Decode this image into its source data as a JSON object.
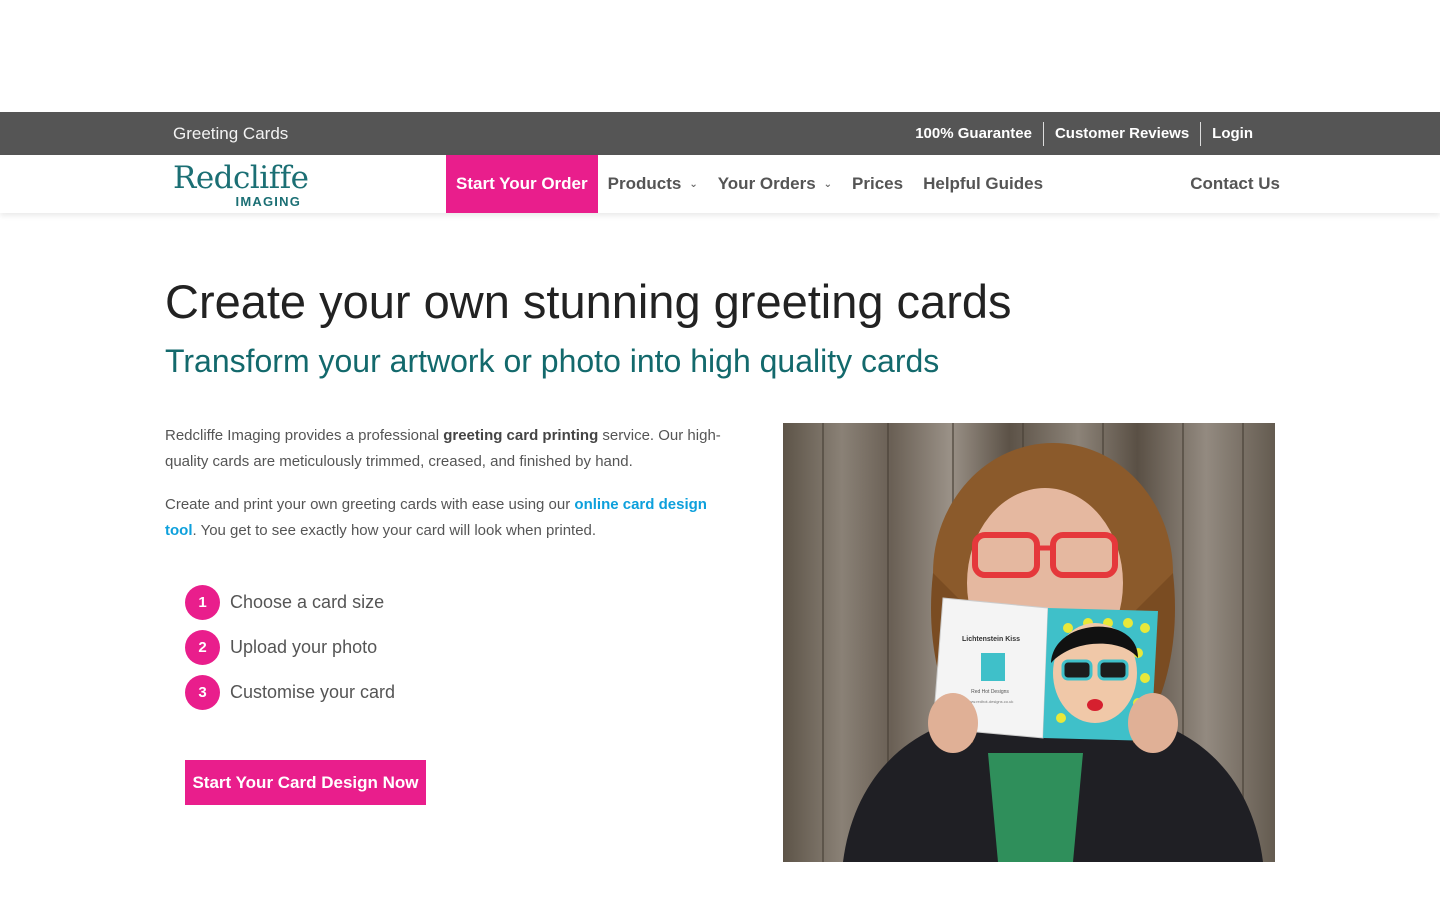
{
  "topbar": {
    "section_title": "Greeting Cards",
    "links": [
      "100% Guarantee",
      "Customer Reviews",
      "Login"
    ]
  },
  "logo": {
    "main": "Redcliffe",
    "sub": "IMAGING"
  },
  "nav": {
    "start_order": "Start Your Order",
    "products": "Products",
    "your_orders": "Your Orders",
    "prices": "Prices",
    "helpful_guides": "Helpful Guides",
    "contact_us": "Contact Us"
  },
  "hero": {
    "title": "Create your own stunning greeting cards",
    "subtitle": "Transform your artwork or photo into high quality cards"
  },
  "intro": {
    "p1_a": "Redcliffe Imaging provides a professional ",
    "p1_bold": "greeting card printing",
    "p1_b": " service. Our high-quality cards are meticulously trimmed, creased, and finished by hand.",
    "p2_a": "Create and print your own greeting cards with ease using our ",
    "p2_link": "online card design tool",
    "p2_b": ". You get to see exactly how your card will look when printed."
  },
  "steps": [
    {
      "num": "1",
      "label": "Choose a card size"
    },
    {
      "num": "2",
      "label": "Upload your photo"
    },
    {
      "num": "3",
      "label": "Customise your card"
    }
  ],
  "cta": {
    "label": "Start Your Card Design Now"
  },
  "photo": {
    "card_title": "Lichtenstein Kiss",
    "card_brand": "Red Hot Designs",
    "card_url": "www.redhot-designs.co.uk"
  },
  "colors": {
    "accent": "#e91e8c",
    "brand_teal": "#13696c",
    "link_blue": "#0da0dc",
    "topbar": "#555555"
  }
}
